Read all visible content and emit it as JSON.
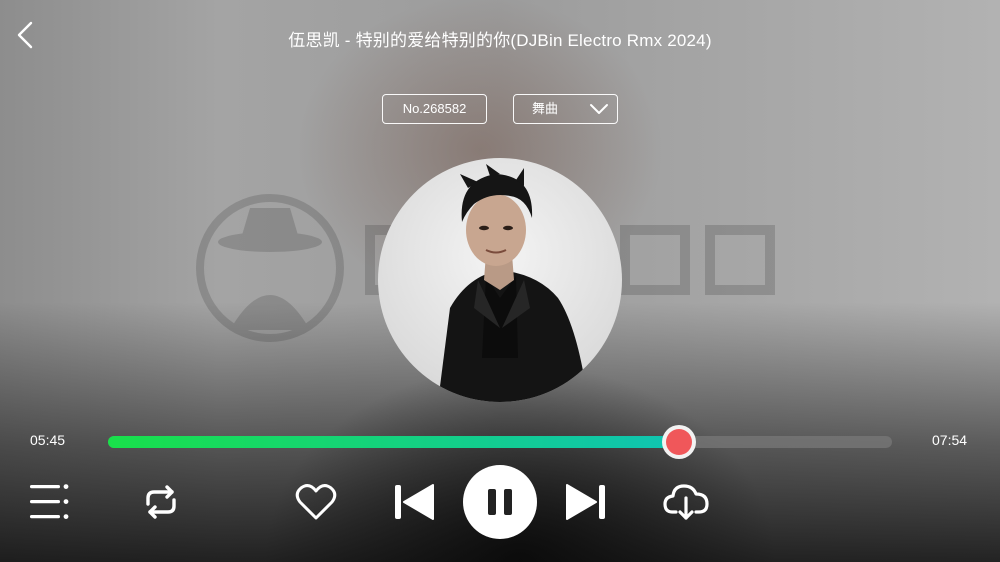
{
  "header": {
    "title": "伍思凯 - 特别的爱给特别的你(DJBin Electro Rmx 2024)"
  },
  "chips": {
    "number": "No.268582",
    "genre": "舞曲"
  },
  "player": {
    "current_time": "05:45",
    "total_time": "07:54",
    "progress_fraction": 0.728,
    "progress_color_start": "#19e04a",
    "progress_color_end": "#0fc4b3",
    "thumb_color": "#f0575a"
  },
  "icons": {
    "back": "chevron-left-icon",
    "genre_dropdown": "chevron-down-icon",
    "playlist": "playlist-icon",
    "repeat": "repeat-icon",
    "favorite": "heart-icon",
    "previous": "skip-previous-icon",
    "pause": "pause-icon",
    "next": "skip-next-icon",
    "download": "cloud-download-icon"
  }
}
